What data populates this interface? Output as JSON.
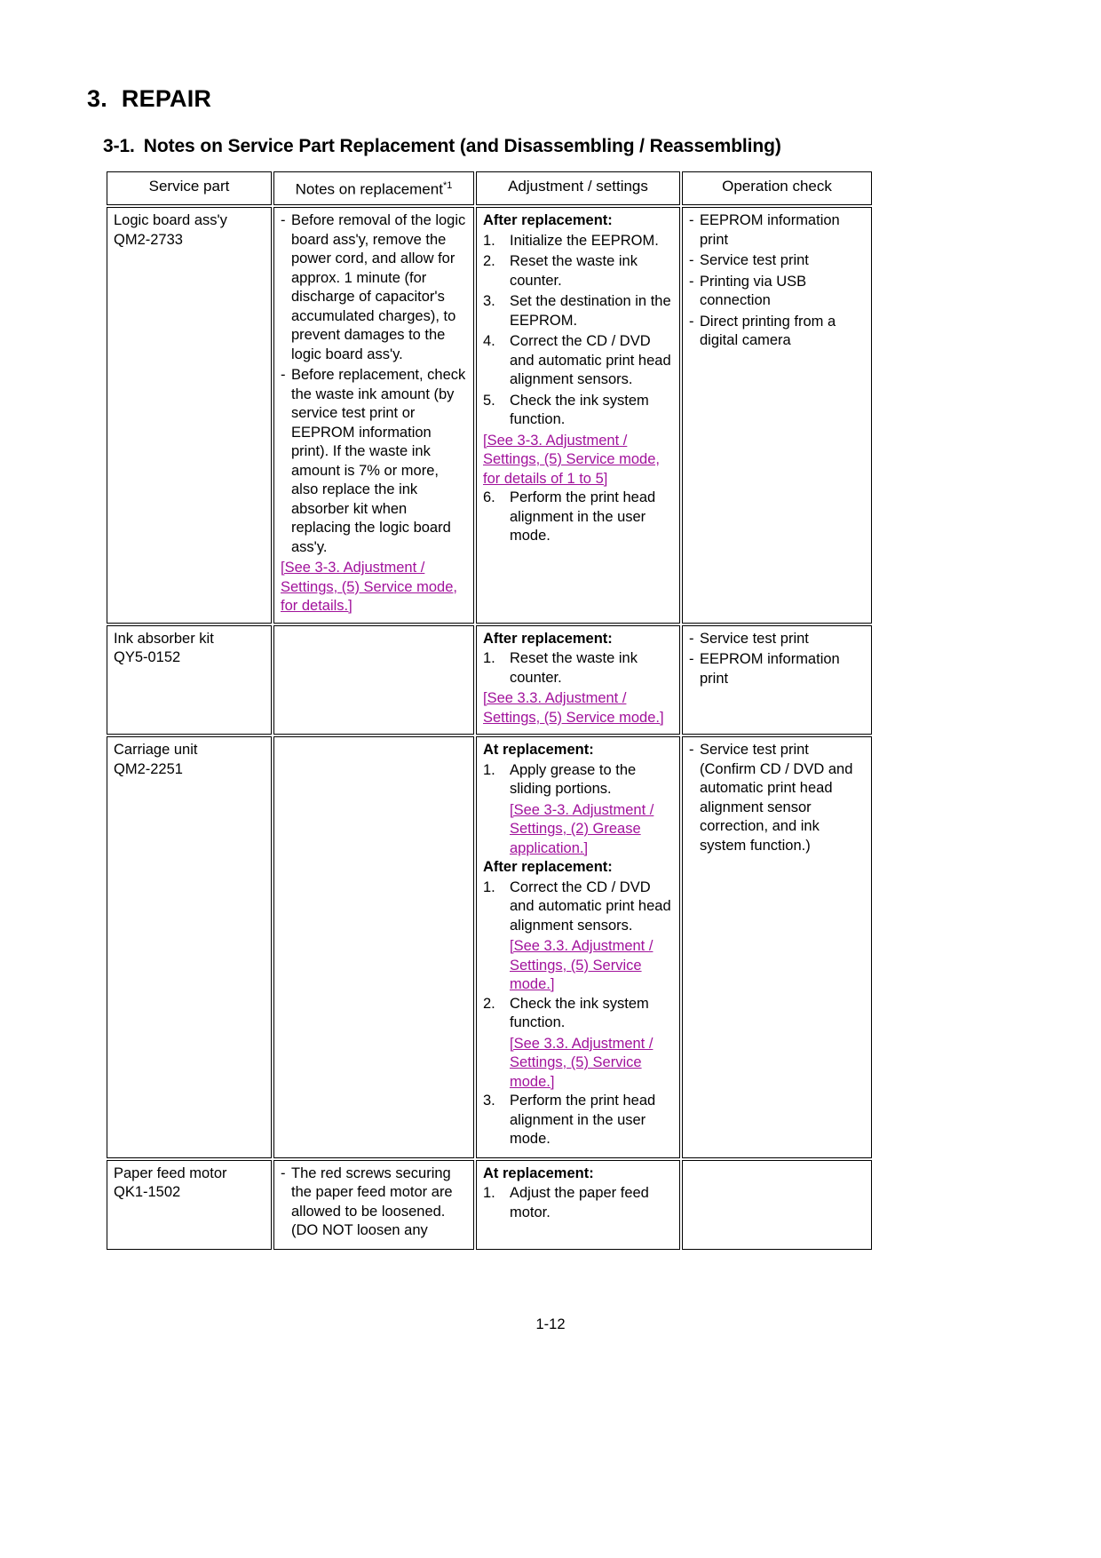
{
  "document": {
    "chapter_number": "3.",
    "chapter_title": "REPAIR",
    "section_number": "3-1.",
    "section_title": "Notes on Service Part Replacement (and Disassembling / Reassembling)",
    "page_number": "1-12"
  },
  "table": {
    "headers": {
      "col1": "Service part",
      "col2": "Notes on replacement",
      "col2_footnote": "*1",
      "col3": "Adjustment / settings",
      "col4": "Operation check"
    },
    "rows": [
      {
        "part_name": "Logic board ass'y",
        "part_number": "QM2-2733",
        "notes": [
          "Before removal of the logic board ass'y, remove the power cord, and allow for approx. 1 minute (for discharge of capacitor's accumulated charges), to prevent damages to the logic board ass'y.",
          "Before replacement, check the waste ink amount (by service test print or EEPROM information print). If the waste ink amount is 7% or more, also replace the ink absorber kit when replacing the logic board ass'y."
        ],
        "notes_ref": "[See 3-3. Adjustment / Settings, (5) Service mode, for details.]",
        "adjust_heading": "After replacement:",
        "adjust_steps": [
          {
            "n": "1.",
            "text": "Initialize the EEPROM."
          },
          {
            "n": "2.",
            "text": "Reset the waste ink counter."
          },
          {
            "n": "3.",
            "text": "Set the destination in the EEPROM."
          },
          {
            "n": "4.",
            "text": "Correct the CD / DVD and automatic print head alignment sensors."
          },
          {
            "n": "5.",
            "text": "Check the ink system function."
          }
        ],
        "adjust_ref": "[See 3-3. Adjustment / Settings, (5) Service mode, for details of 1 to 5]",
        "adjust_steps_after": [
          {
            "n": "6.",
            "text": "Perform the print head alignment in the user mode."
          }
        ],
        "operation_checks": [
          "EEPROM information print",
          "Service test print",
          "Printing via USB connection",
          "Direct printing from a digital camera"
        ]
      },
      {
        "part_name": "Ink absorber kit",
        "part_number": "QY5-0152",
        "notes": [],
        "adjust_heading": "After replacement:",
        "adjust_steps": [
          {
            "n": "1.",
            "text": "Reset the waste ink counter."
          }
        ],
        "adjust_ref": "[See 3.3. Adjustment / Settings, (5) Service mode.]",
        "operation_checks": [
          "Service test print",
          "EEPROM information print"
        ]
      },
      {
        "part_name": "Carriage unit",
        "part_number": "QM2-2251",
        "notes": [],
        "adjust_heading_1": "At replacement:",
        "adjust_steps_1": [
          {
            "n": "1.",
            "text": "Apply grease to the sliding portions."
          }
        ],
        "adjust_ref_1": "[See 3-3. Adjustment / Settings, (2) Grease application.]",
        "adjust_heading_2": "After replacement:",
        "adjust_steps_2": [
          {
            "n": "1.",
            "text": "Correct the CD / DVD and automatic print head alignment sensors."
          }
        ],
        "adjust_ref_2": "[See 3.3. Adjustment / Settings, (5) Service mode.]",
        "adjust_steps_3": [
          {
            "n": "2.",
            "text": "Check the ink system function."
          }
        ],
        "adjust_ref_3": "[See 3.3. Adjustment / Settings, (5) Service mode.]",
        "adjust_steps_4": [
          {
            "n": "3.",
            "text": "Perform the print head alignment in the user mode."
          }
        ],
        "operation_checks": [
          "Service test print (Confirm CD / DVD and automatic print head alignment sensor correction, and ink system function.)"
        ]
      },
      {
        "part_name": "Paper feed motor",
        "part_number": "QK1-1502",
        "notes": [
          "The red screws securing the paper feed motor are allowed to be loosened. (DO NOT loosen any"
        ],
        "adjust_heading": "At replacement:",
        "adjust_steps": [
          {
            "n": "1.",
            "text": "Adjust the paper feed motor."
          }
        ],
        "operation_checks": []
      }
    ]
  },
  "colors": {
    "link": "#a1129b",
    "text": "#000000",
    "border": "#000000"
  }
}
